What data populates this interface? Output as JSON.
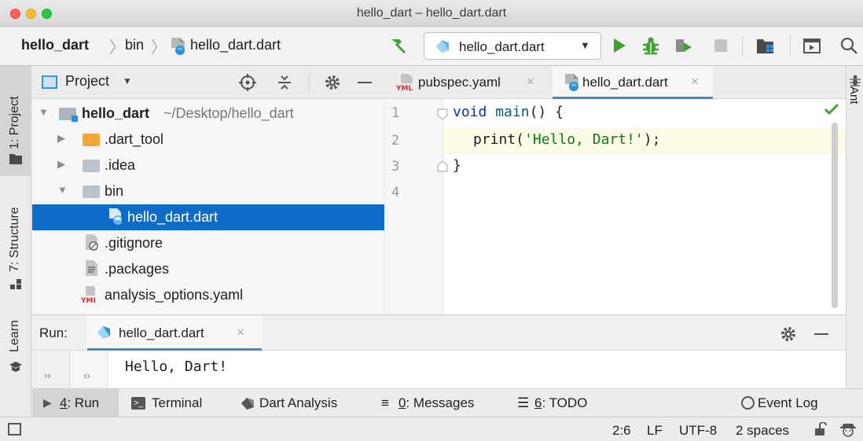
{
  "window": {
    "title": "hello_dart – hello_dart.dart"
  },
  "navbar": {
    "breadcrumb_project": "hello_dart",
    "breadcrumb_folder": "bin",
    "breadcrumb_file": "hello_dart.dart",
    "run_config": "hello_dart.dart"
  },
  "left_strip": {
    "project": "1: Project",
    "structure": "7: Structure",
    "learn": "Learn"
  },
  "right_strip": {
    "ant": "Ant"
  },
  "project_panel": {
    "title": "Project",
    "root_name": "hello_dart",
    "root_path": "~/Desktop/hello_dart",
    "items": [
      {
        "label": ".dart_tool"
      },
      {
        "label": ".idea"
      },
      {
        "label": "bin"
      },
      {
        "label": "hello_dart.dart"
      },
      {
        "label": ".gitignore"
      },
      {
        "label": ".packages"
      },
      {
        "label": "analysis_options.yaml"
      }
    ]
  },
  "editor": {
    "tabs": [
      {
        "label": "pubspec.yaml",
        "icon_text": "YML"
      },
      {
        "label": "hello_dart.dart"
      }
    ],
    "line_numbers": [
      "1",
      "2",
      "3",
      "4"
    ],
    "code": {
      "l1_keyword": "void",
      "l1_func": "main",
      "l1_rest": "() {",
      "l2_call": "print(",
      "l2_string": "'Hello, Dart!'",
      "l2_end": ");",
      "l3": "}"
    }
  },
  "run_panel": {
    "label": "Run:",
    "tab": "hello_dart.dart",
    "output": "Hello, Dart!"
  },
  "tool_tabs": {
    "run_num": "4",
    "run_text": ": Run",
    "terminal": "Terminal",
    "dart_analysis": "Dart Analysis",
    "messages_num": "0",
    "messages_text": ": Messages",
    "todo_num": "6",
    "todo_text": ": TODO",
    "event_log": "Event Log"
  },
  "status_bar": {
    "position": "2:6",
    "line_sep": "LF",
    "encoding": "UTF-8",
    "indent": "2 spaces"
  },
  "colors": {
    "selection": "#0e6cc9",
    "run_green": "#3fa130",
    "keyword_blue": "#0b31b7",
    "string_green": "#077d17",
    "dart_blue": "#2a8fd6"
  }
}
